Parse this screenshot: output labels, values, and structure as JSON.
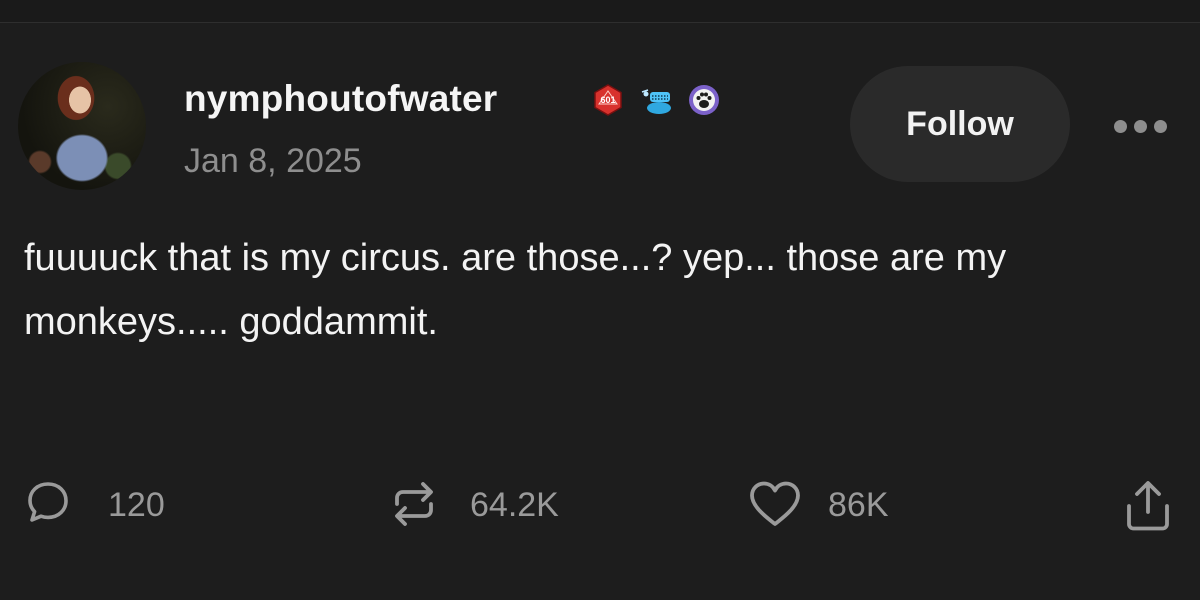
{
  "post": {
    "author": {
      "username": "nymphoutofwater",
      "badges": [
        {
          "icon": "d20-dice-icon",
          "text": "601",
          "color": "#d8322d"
        },
        {
          "icon": "rat-icon",
          "color": "#2fa8e0"
        },
        {
          "icon": "paw-print-icon",
          "color": "#7b61c9"
        }
      ]
    },
    "date": "Jan 8, 2025",
    "text": "fuuuuck that is my circus. are those...? yep... those are my monkeys..... goddammit.",
    "follow_label": "Follow",
    "stats": {
      "replies": "120",
      "reposts": "64.2K",
      "likes": "86K"
    }
  },
  "icons": {
    "reply": "speech-bubble-icon",
    "repost": "repost-arrows-icon",
    "like": "heart-icon",
    "share": "share-upload-icon",
    "more": "more-dots-icon"
  },
  "colors": {
    "background": "#1d1d1d",
    "text_primary": "#f3f3f3",
    "text_secondary": "#8e8e8e",
    "button_bg": "#2a2a2a"
  }
}
